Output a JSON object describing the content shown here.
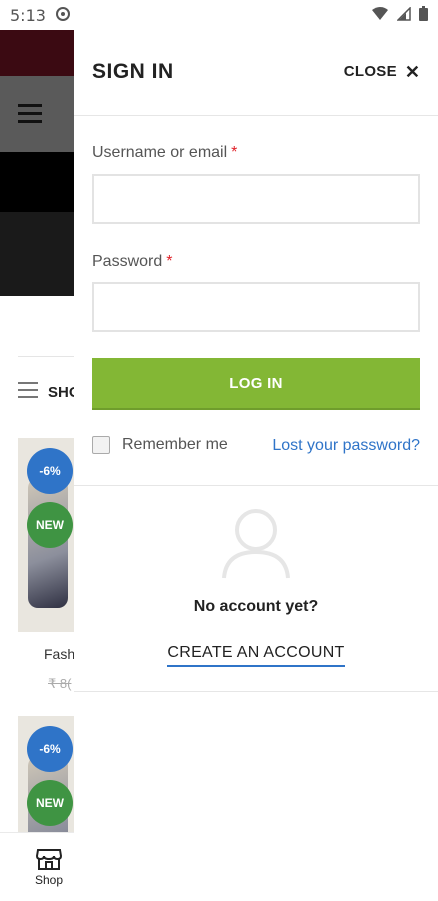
{
  "status_bar": {
    "time": "5:13"
  },
  "background_page": {
    "shop_label": "SHO",
    "products": [
      {
        "discount_badge": "-6%",
        "new_badge": "NEW",
        "name": "Fash",
        "price": "₹ 8("
      },
      {
        "discount_badge": "-6%",
        "new_badge": "NEW"
      }
    ]
  },
  "drawer": {
    "title": "SIGN IN",
    "close_label": "CLOSE",
    "username_label": "Username or email",
    "password_label": "Password",
    "required_mark": "*",
    "username_value": "",
    "password_value": "",
    "login_button": "LOG IN",
    "remember_label": "Remember me",
    "lost_password": "Lost your password?",
    "no_account": "No account yet?",
    "create_account": "CREATE AN ACCOUNT"
  },
  "bottom_nav": {
    "shop_label": "Shop"
  },
  "colors": {
    "accent_green": "#83b735",
    "link_blue": "#2f74c8",
    "sale_badge": "#2f74c8",
    "new_badge": "#3f9443"
  }
}
